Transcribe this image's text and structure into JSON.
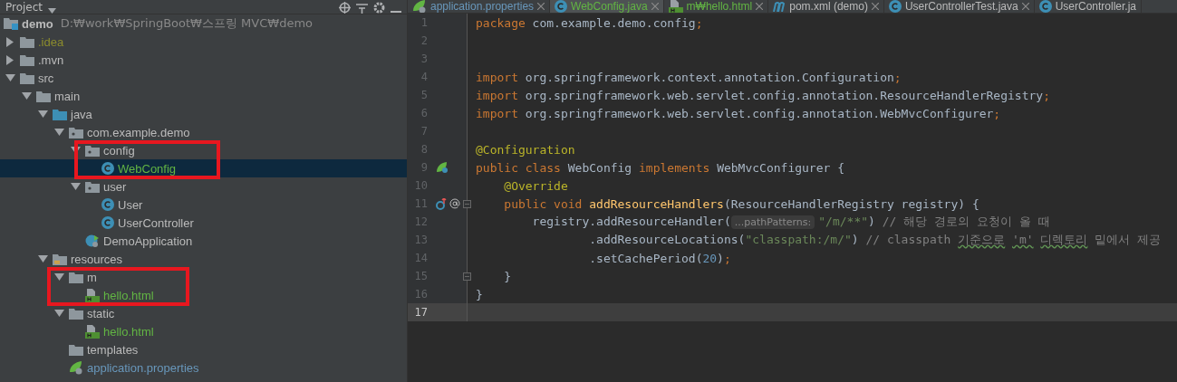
{
  "project_panel": {
    "title": "Project",
    "tree": [
      {
        "label": "demo",
        "path": "D:₩work₩SpringBoot₩스프링 MVC₩demo",
        "kind": "module",
        "selected": false,
        "children": [
          {
            "label": ".idea",
            "kind": "folder",
            "color": "#8c8c2d",
            "expanded": false,
            "selected": false
          },
          {
            "label": ".mvn",
            "kind": "folder",
            "expanded": false,
            "selected": false
          },
          {
            "label": "src",
            "kind": "folder",
            "expanded": true,
            "selected": false,
            "children": [
              {
                "label": "main",
                "kind": "folder",
                "expanded": true,
                "selected": false,
                "children": [
                  {
                    "label": "java",
                    "kind": "source-folder",
                    "expanded": true,
                    "selected": false,
                    "children": [
                      {
                        "label": "com.example.demo",
                        "kind": "package",
                        "expanded": true,
                        "selected": false,
                        "children": [
                          {
                            "label": "config",
                            "kind": "package",
                            "expanded": true,
                            "selected": false,
                            "children": [
                              {
                                "label": "WebConfig",
                                "kind": "class",
                                "color": "#62b543",
                                "selected": true
                              }
                            ]
                          },
                          {
                            "label": "user",
                            "kind": "package",
                            "expanded": true,
                            "selected": false,
                            "children": [
                              {
                                "label": "User",
                                "kind": "class",
                                "selected": false
                              },
                              {
                                "label": "UserController",
                                "kind": "class",
                                "selected": false
                              }
                            ]
                          },
                          {
                            "label": "DemoApplication",
                            "kind": "spring-class",
                            "selected": false
                          }
                        ]
                      }
                    ]
                  },
                  {
                    "label": "resources",
                    "kind": "resources-folder",
                    "expanded": true,
                    "selected": false,
                    "children": [
                      {
                        "label": "m",
                        "kind": "folder",
                        "expanded": true,
                        "selected": false,
                        "children": [
                          {
                            "label": "hello.html",
                            "kind": "html",
                            "color": "#62b543",
                            "selected": false
                          }
                        ]
                      },
                      {
                        "label": "static",
                        "kind": "folder",
                        "expanded": true,
                        "selected": false,
                        "children": [
                          {
                            "label": "hello.html",
                            "kind": "html",
                            "color": "#62b543",
                            "selected": false
                          }
                        ]
                      },
                      {
                        "label": "templates",
                        "kind": "folder",
                        "selected": false
                      },
                      {
                        "label": "application.properties",
                        "kind": "properties",
                        "color": "#6897bb",
                        "selected": false
                      }
                    ]
                  }
                ]
              }
            ]
          }
        ]
      }
    ]
  },
  "editor": {
    "tabs": [
      {
        "label": "application.properties",
        "kind": "properties",
        "color": "#6897bb",
        "selected": false
      },
      {
        "label": "WebConfig.java",
        "kind": "class",
        "color": "#62b543",
        "selected": true
      },
      {
        "label": "m₩hello.html",
        "kind": "html",
        "color": "#62b543",
        "selected": false
      },
      {
        "label": "pom.xml (demo)",
        "kind": "maven",
        "selected": false
      },
      {
        "label": "UserControllerTest.java",
        "kind": "class",
        "selected": false
      },
      {
        "label": "UserController.ja",
        "kind": "class",
        "selected": false
      }
    ],
    "lines": [
      {
        "number": "1",
        "current": false,
        "tokens": [
          {
            "kind": "keyword",
            "text": "package"
          },
          {
            "kind": "plain",
            "text": " com.example.demo.config"
          },
          {
            "kind": "keyword",
            "text": ";"
          }
        ]
      },
      {
        "number": "2",
        "current": false
      },
      {
        "number": "3",
        "current": false
      },
      {
        "number": "4",
        "current": false,
        "tokens": [
          {
            "kind": "keyword",
            "text": "import"
          },
          {
            "kind": "plain",
            "text": " org.springframework.context.annotation.Configuration"
          },
          {
            "kind": "keyword",
            "text": ";"
          }
        ]
      },
      {
        "number": "5",
        "current": false,
        "tokens": [
          {
            "kind": "keyword",
            "text": "import"
          },
          {
            "kind": "plain",
            "text": " org.springframework.web.servlet.config.annotation.ResourceHandlerRegistry"
          },
          {
            "kind": "keyword",
            "text": ";"
          }
        ]
      },
      {
        "number": "6",
        "current": false,
        "tokens": [
          {
            "kind": "keyword",
            "text": "import"
          },
          {
            "kind": "plain",
            "text": " org.springframework.web.servlet.config.annotation.WebMvcConfigurer"
          },
          {
            "kind": "keyword",
            "text": ";"
          }
        ]
      },
      {
        "number": "7",
        "current": false
      },
      {
        "number": "8",
        "current": false,
        "tokens": [
          {
            "kind": "annotation",
            "text": "@Configuration"
          }
        ]
      },
      {
        "number": "9",
        "current": false,
        "gutter": [
          {
            "kind": "bean"
          }
        ],
        "tokens": [
          {
            "kind": "keyword",
            "text": "public class "
          },
          {
            "kind": "plain",
            "text": "WebConfig "
          },
          {
            "kind": "keyword",
            "text": "implements "
          },
          {
            "kind": "plain",
            "text": "WebMvcConfigurer {"
          }
        ]
      },
      {
        "number": "10",
        "current": false,
        "tokens": [
          {
            "kind": "annotation",
            "text": "    @Override"
          }
        ]
      },
      {
        "number": "11",
        "current": false,
        "gutter": [
          {
            "kind": "override"
          },
          {
            "kind": "at"
          },
          {
            "kind": "fold"
          }
        ],
        "tokens": [
          {
            "kind": "keyword",
            "text": "    public void "
          },
          {
            "kind": "method",
            "text": "addResourceHandlers"
          },
          {
            "kind": "plain",
            "text": "(ResourceHandlerRegistry registry) {"
          }
        ]
      },
      {
        "number": "12",
        "current": false,
        "tokens": [
          {
            "kind": "plain",
            "text": "        registry.addResourceHandler("
          },
          {
            "kind": "hint",
            "text": "...pathPatterns:"
          },
          {
            "kind": "string",
            "text": "\"/m/**\""
          },
          {
            "kind": "plain",
            "text": ") "
          },
          {
            "kind": "comment",
            "text": "// 해당 경로의 요청이 올 때"
          }
        ]
      },
      {
        "number": "13",
        "current": false,
        "tokens": [
          {
            "kind": "plain",
            "text": "                .addResourceLocations("
          },
          {
            "kind": "string",
            "text": "\"classpath:/m/\""
          },
          {
            "kind": "plain",
            "text": ") "
          },
          {
            "kind": "comment",
            "text": "// classpath "
          },
          {
            "kind": "typo",
            "text": "기준으로"
          },
          {
            "kind": "typo",
            "text": " 'm'"
          },
          {
            "kind": "typo",
            "text": " 디렉토리"
          },
          {
            "kind": "comment",
            "text": " 밑에서 제공"
          }
        ]
      },
      {
        "number": "14",
        "current": false,
        "tokens": [
          {
            "kind": "plain",
            "text": "                .setCachePeriod("
          },
          {
            "kind": "number",
            "text": "20"
          },
          {
            "kind": "plain",
            "text": ")"
          },
          {
            "kind": "keyword",
            "text": ";"
          }
        ]
      },
      {
        "number": "15",
        "current": false,
        "gutter": [
          {
            "kind": "fold"
          }
        ],
        "tokens": [
          {
            "kind": "plain",
            "text": "    }"
          }
        ]
      },
      {
        "number": "16",
        "current": false,
        "tokens": [
          {
            "kind": "plain",
            "text": "}"
          }
        ]
      },
      {
        "number": "17",
        "current": true
      }
    ]
  }
}
